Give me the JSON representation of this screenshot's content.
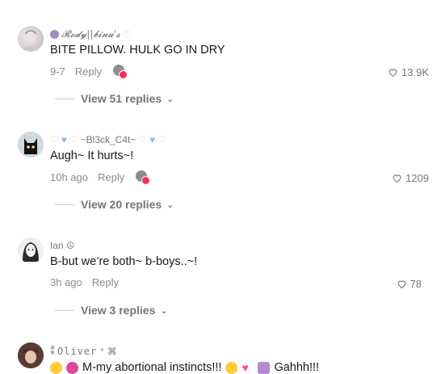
{
  "comments": [
    {
      "username": "𝓡𝓸𝓭𝔂||𝓫𝓲𝓷𝓪'𝓼",
      "text": "BITE PILLOW. HULK GO IN DRY",
      "time": "9-7",
      "reply_label": "Reply",
      "likes": "13.9K",
      "replies_label": "View 51 replies"
    },
    {
      "username": "~Bl3ck_C4t~",
      "text": "Augh~ It hurts~!",
      "time": "10h ago",
      "reply_label": "Reply",
      "likes": "1209",
      "replies_label": "View 20 replies"
    },
    {
      "username": "Ian",
      "text": "B-but we’re both~ b-boys..~!",
      "time": "3h ago",
      "reply_label": "Reply",
      "likes": "78",
      "replies_label": "View 3 replies"
    },
    {
      "username": "Oliver",
      "text": "M-my abortional instincts!!!",
      "text_end": "Gahhh!!!"
    }
  ],
  "colors": {
    "accent": "#fe2c55",
    "muted": "#73757c"
  }
}
